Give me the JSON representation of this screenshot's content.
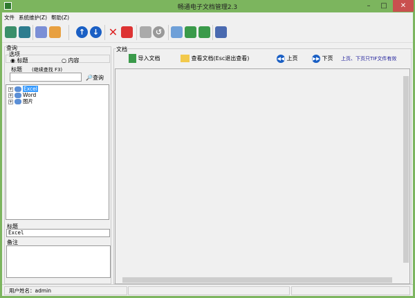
{
  "window": {
    "title": "畅通电子文档管理2.3",
    "minimize": "–",
    "maximize": "□",
    "close": "✕"
  },
  "menu": [
    "文件",
    "系统维护(Z)",
    "帮助(Z)"
  ],
  "toolbar": {
    "icons": [
      "add-record-icon",
      "add-child-icon",
      "indent-icon",
      "paste-icon",
      "move-up-icon",
      "move-down-icon",
      "delete-icon",
      "edit-icon",
      "save-icon",
      "undo-icon",
      "import-image-icon",
      "export-doc-icon",
      "export-doc2-icon",
      "exit-icon"
    ]
  },
  "query": {
    "group_label": "查询",
    "options_label": "选项",
    "option_title": "标题",
    "option_content": "内容",
    "title_label": "标题",
    "hint": "(继续查找 F3)",
    "search_value": "",
    "search_button": "查询"
  },
  "tree": {
    "items": [
      "Excel",
      "Word",
      "图片"
    ],
    "selected": "Excel"
  },
  "details": {
    "title_label": "标题",
    "title_value": "Excel",
    "notes_label": "备注",
    "notes_value": ""
  },
  "document": {
    "group_label": "文档",
    "import_button": "导入文档",
    "view_button": "查看文档(Esc退出查看)",
    "prev_button": "上页",
    "next_button": "下页",
    "page_hint": "上页、下页只TIF文件有效"
  },
  "status": {
    "user": "用户姓名：admin",
    "panel2": "",
    "panel3": ""
  },
  "colors": {
    "frame": "#7cb55e",
    "close": "#c9504f",
    "hint": "#1a1a99",
    "accent": "#1a5fc4"
  }
}
